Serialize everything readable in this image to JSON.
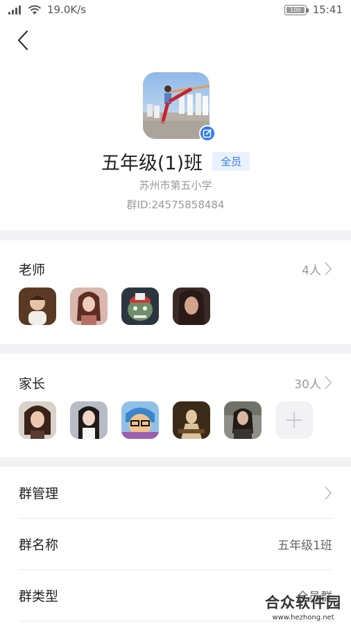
{
  "status_bar": {
    "network_speed": "19.0K/s",
    "battery": "100",
    "time": "15:41"
  },
  "header": {
    "back_icon": "chevron-left-icon"
  },
  "group": {
    "name": "五年级(1)班",
    "tag": "全员",
    "school": "苏州市第五小学",
    "id_text": "群ID:24575858484"
  },
  "teachers": {
    "title": "老师",
    "count": "4人",
    "avatars": [
      "teacher-1",
      "teacher-2",
      "teacher-3",
      "teacher-4"
    ]
  },
  "parents": {
    "title": "家长",
    "count": "30人",
    "avatars": [
      "parent-1",
      "parent-2",
      "parent-3",
      "parent-4",
      "parent-5"
    ]
  },
  "settings": {
    "manage_label": "群管理",
    "name_label": "群名称",
    "name_value": "五年级1班",
    "type_label": "群类型",
    "type_value": "全员群"
  },
  "watermark": {
    "title": "合众软件园",
    "url": "www.hezhong.net"
  },
  "colors": {
    "accent": "#2f7cf6",
    "tag_bg": "#e8f1fd",
    "tag_text": "#3c7ee0",
    "divider": "#f2f2f4"
  }
}
